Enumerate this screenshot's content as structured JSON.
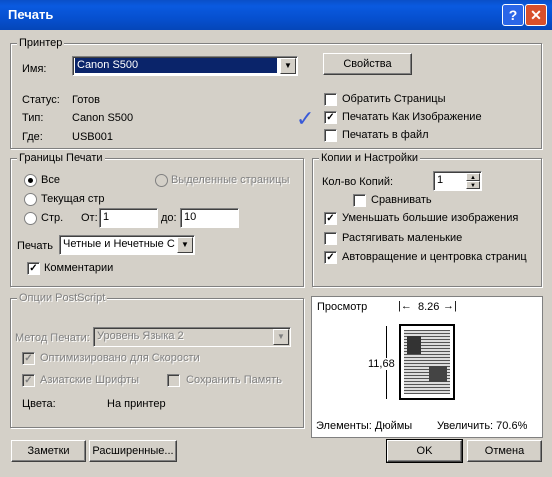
{
  "window": {
    "title": "Печать",
    "help_label": "?",
    "close_label": "✕"
  },
  "printer": {
    "group_label": "Принтер",
    "name_label": "Имя:",
    "name_value": "Canon S500",
    "properties_button": "Свойства",
    "status_label": "Статус:",
    "status_value": "Готов",
    "type_label": "Тип:",
    "type_value": "Canon S500",
    "where_label": "Где:",
    "where_value": "USB001",
    "options": [
      {
        "label": "Обратить Страницы",
        "checked": false
      },
      {
        "label": "Печатать Как Изображение",
        "checked": true
      },
      {
        "label": "Печатать в файл",
        "checked": false
      }
    ],
    "annotation_mark": "✓"
  },
  "range": {
    "group_label": "Границы Печати",
    "all_label": "Все",
    "selection_label": "Выделенные страницы",
    "current_label": "Текущая стр",
    "pages_label": "Стр.",
    "from_label": "От:",
    "from_value": "1",
    "to_label": "до:",
    "to_value": "10",
    "print_label": "Печать",
    "print_value": "Четные и Нечетные С",
    "comments_label": "Комментарии",
    "comments_checked": true
  },
  "copies": {
    "group_label": "Копии и Настройки",
    "count_label": "Кол-во Копий:",
    "count_value": "1",
    "options": [
      {
        "label": "Сравнивать",
        "checked": false
      },
      {
        "label": "Уменьшать большие изображения",
        "checked": true
      },
      {
        "label": "Растягивать маленькие",
        "checked": false
      },
      {
        "label": "Автовращение и центровка страниц",
        "checked": true
      }
    ]
  },
  "postscript": {
    "group_label": "Опции PostScript",
    "method_label": "Метод Печати:",
    "method_value": "Уровень Языка 2",
    "optimize_label": "Оптимизировано для Скорости",
    "asian_fonts_label": "Азиатские Шрифты",
    "save_memory_label": "Сохранить Память",
    "colors_label": "Цвета:",
    "colors_value": "На принтер"
  },
  "preview": {
    "label": "Просмотр",
    "width_value": "8.26",
    "height_value": "11,68",
    "units_text": "Элементы: Дюймы",
    "zoom_text": "Увеличить: 70.6%"
  },
  "buttons": {
    "notes": "Заметки",
    "advanced": "Расширенные...",
    "ok": "OK",
    "cancel": "Отмена"
  }
}
